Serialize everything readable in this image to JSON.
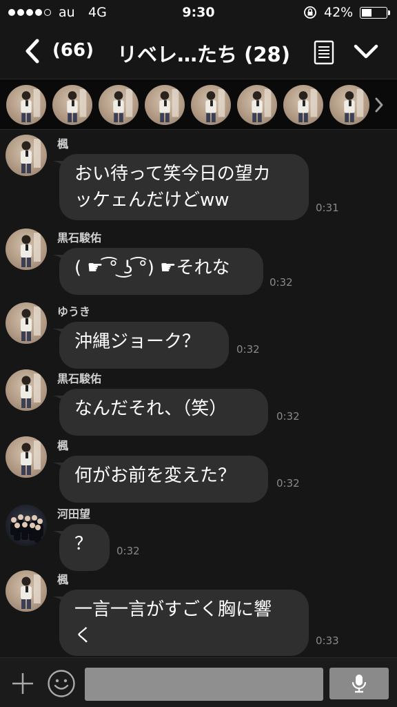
{
  "status_bar": {
    "carrier": "au",
    "network": "4G",
    "time": "9:30",
    "battery_percent_text": "42%",
    "battery_level": 0.42,
    "signal_bars_filled": 4,
    "signal_bars_total": 5
  },
  "nav": {
    "back_count": "(66)",
    "title": "リベレ…たち (28)"
  },
  "members": {
    "visible_count": 8
  },
  "messages": [
    {
      "sender": "楓",
      "text": "おい待って笑今日の望カッケェんだけどww",
      "lines": [
        "おい待って笑今日の望カ",
        "ッケェんだけどww"
      ],
      "time": "0:31",
      "avatar": "person-photo"
    },
    {
      "sender": "黒石駿佑",
      "text": "( ☛ ͡° ͜ʖ ͡°) ☛それな",
      "lines": [
        "( ☛ ͡° ͜ʖ ͡°) ☛それな"
      ],
      "time": "0:32",
      "avatar": "person-photo"
    },
    {
      "sender": "ゆうき",
      "text": "沖縄ジョーク？",
      "lines": [
        "沖縄ジョーク？"
      ],
      "time": "0:32",
      "avatar": "person-photo"
    },
    {
      "sender": "黒石駿佑",
      "text": "なんだそれ、（笑）",
      "lines": [
        "なんだそれ、（笑）"
      ],
      "time": "0:32",
      "avatar": "person-photo"
    },
    {
      "sender": "楓",
      "text": "何がお前を変えた？",
      "lines": [
        "何がお前を変えた？"
      ],
      "time": "0:32",
      "avatar": "person-photo"
    },
    {
      "sender": "河田望",
      "text": "？",
      "lines": [
        "？"
      ],
      "time": "0:32",
      "avatar": "group-photo"
    },
    {
      "sender": "楓",
      "text": "一言一言がすごく胸に響く",
      "lines": [
        "一言一言がすごく胸に響",
        "く"
      ],
      "time": "0:33",
      "avatar": "person-photo"
    }
  ],
  "input_bar": {
    "placeholder": ""
  },
  "colors": {
    "background": "#161616",
    "bubble": "#2f2f2f",
    "member_strip": "#0a0a0a",
    "timestamp": "#8a8a8a"
  },
  "icons": [
    "back-chevron-icon",
    "note-icon",
    "chevron-down-icon",
    "chevron-right-icon",
    "plus-icon",
    "emoji-icon",
    "microphone-icon",
    "rotation-lock-icon",
    "battery-icon"
  ]
}
